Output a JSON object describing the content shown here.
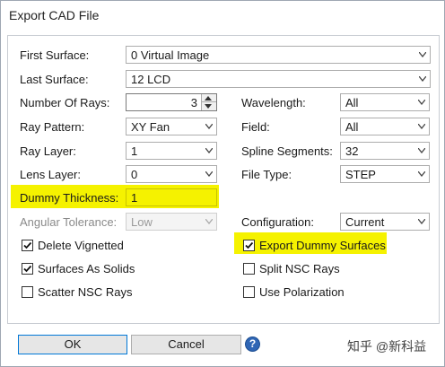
{
  "window": {
    "title": "Export CAD File"
  },
  "fields": {
    "first_surface": {
      "label": "First Surface:",
      "value": "0 Virtual Image"
    },
    "last_surface": {
      "label": "Last Surface:",
      "value": "12 LCD"
    },
    "number_of_rays": {
      "label": "Number Of Rays:",
      "value": "3"
    },
    "wavelength": {
      "label": "Wavelength:",
      "value": "All"
    },
    "ray_pattern": {
      "label": "Ray Pattern:",
      "value": "XY Fan"
    },
    "field": {
      "label": "Field:",
      "value": "All"
    },
    "ray_layer": {
      "label": "Ray Layer:",
      "value": "1"
    },
    "spline_segments": {
      "label": "Spline Segments:",
      "value": "32"
    },
    "lens_layer": {
      "label": "Lens Layer:",
      "value": "0"
    },
    "file_type": {
      "label": "File Type:",
      "value": "STEP"
    },
    "dummy_thickness": {
      "label": "Dummy Thickness:",
      "value": "1"
    },
    "angular_tolerance": {
      "label": "Angular Tolerance:",
      "value": "Low"
    },
    "configuration": {
      "label": "Configuration:",
      "value": "Current"
    }
  },
  "checkboxes": {
    "delete_vignetted": {
      "label": "Delete Vignetted",
      "checked": true
    },
    "export_dummy_surfaces": {
      "label": "Export Dummy Surfaces",
      "checked": true
    },
    "surfaces_as_solids": {
      "label": "Surfaces As Solids",
      "checked": true
    },
    "split_nsc_rays": {
      "label": "Split NSC Rays",
      "checked": false
    },
    "scatter_nsc_rays": {
      "label": "Scatter NSC Rays",
      "checked": false
    },
    "use_polarization": {
      "label": "Use Polarization",
      "checked": false
    }
  },
  "buttons": {
    "ok": "OK",
    "cancel": "Cancel",
    "help": "?"
  },
  "highlight_color": "#f5f200",
  "watermark": "知乎 @新科益"
}
